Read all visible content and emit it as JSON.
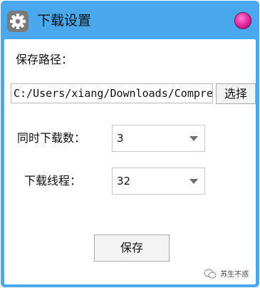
{
  "window": {
    "title": "下载设置",
    "accent": "#4aa8ef",
    "icons": {
      "title_icon": "gear-icon",
      "close": "close-icon"
    }
  },
  "save_path": {
    "label": "保存路径：",
    "value": "C:/Users/xiang/Downloads/Compress",
    "browse_label": "选择"
  },
  "concurrent": {
    "label": "同时下载数：",
    "selected": "3"
  },
  "threads": {
    "label": "下载线程：",
    "selected": "32"
  },
  "save_button": {
    "label": "保存"
  },
  "watermark": {
    "text": "苏生不惑",
    "icon": "wechat-icon"
  }
}
